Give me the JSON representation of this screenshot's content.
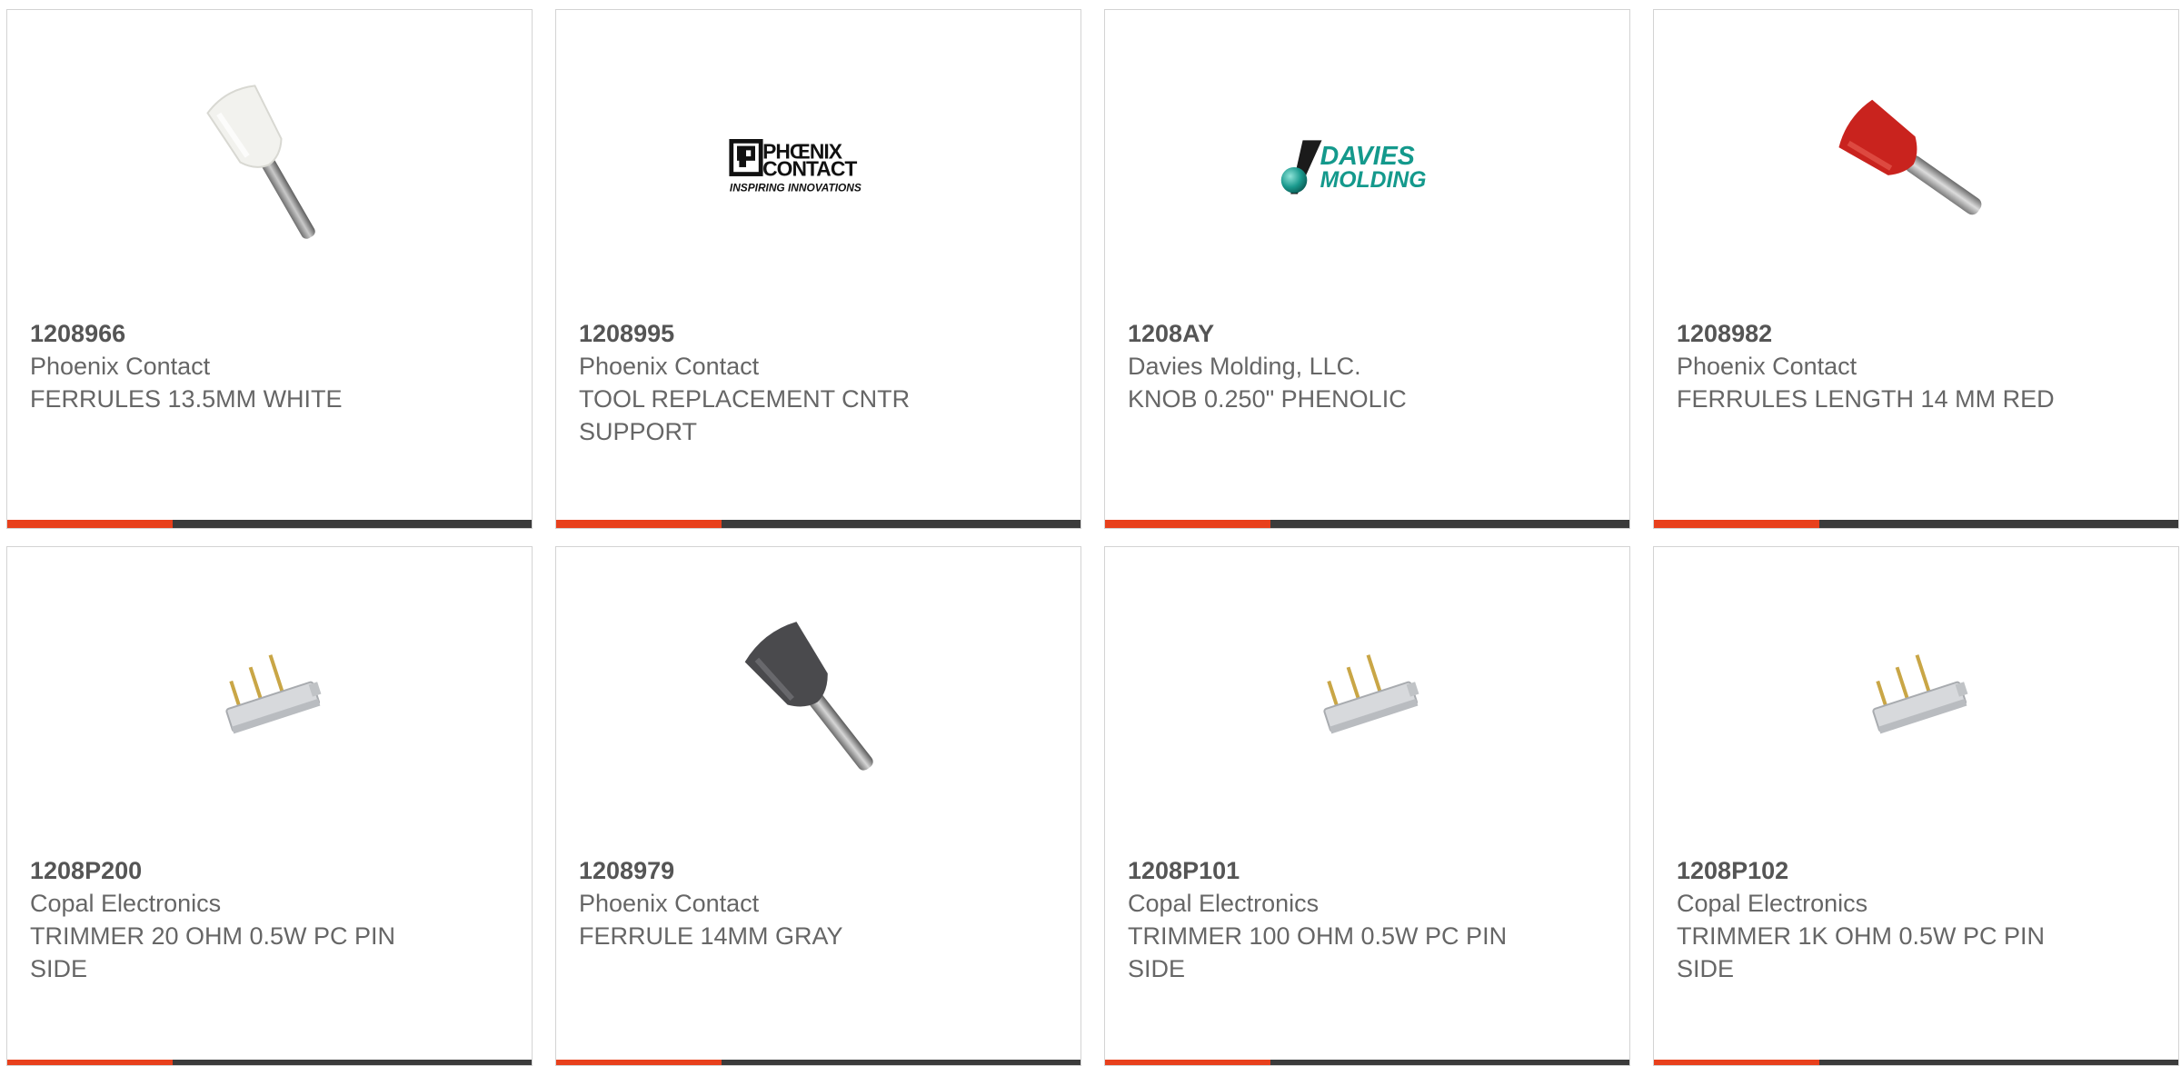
{
  "accent_color": "#e8401c",
  "bar_color": "#3b3b3b",
  "products": [
    {
      "part_number": "1208966",
      "manufacturer": "Phoenix Contact",
      "description": "FERRULES 13.5MM WHITE",
      "image": "white-ferrule"
    },
    {
      "part_number": "1208995",
      "manufacturer": "Phoenix Contact",
      "description": "TOOL REPLACEMENT CNTR SUPPORT",
      "image": "phoenix-contact-logo",
      "logo": {
        "line1": "PHŒNIX",
        "line2": "CONTACT",
        "tagline": "INSPIRING INNOVATIONS"
      }
    },
    {
      "part_number": "1208AY",
      "manufacturer": "Davies Molding, LLC.",
      "description": "KNOB 0.250\" PHENOLIC",
      "image": "davies-molding-logo",
      "logo": {
        "line1": "DAVIES",
        "line2": "MOLDING"
      }
    },
    {
      "part_number": "1208982",
      "manufacturer": "Phoenix Contact",
      "description": "FERRULES LENGTH 14 MM RED",
      "image": "red-ferrule"
    },
    {
      "part_number": "1208P200",
      "manufacturer": "Copal Electronics",
      "description": "TRIMMER 20 OHM 0.5W PC PIN SIDE",
      "image": "trimmer"
    },
    {
      "part_number": "1208979",
      "manufacturer": "Phoenix Contact",
      "description": "FERRULE 14MM GRAY",
      "image": "gray-ferrule"
    },
    {
      "part_number": "1208P101",
      "manufacturer": "Copal Electronics",
      "description": "TRIMMER 100 OHM 0.5W PC PIN SIDE",
      "image": "trimmer"
    },
    {
      "part_number": "1208P102",
      "manufacturer": "Copal Electronics",
      "description": "TRIMMER 1K OHM 0.5W PC PIN SIDE",
      "image": "trimmer"
    }
  ]
}
